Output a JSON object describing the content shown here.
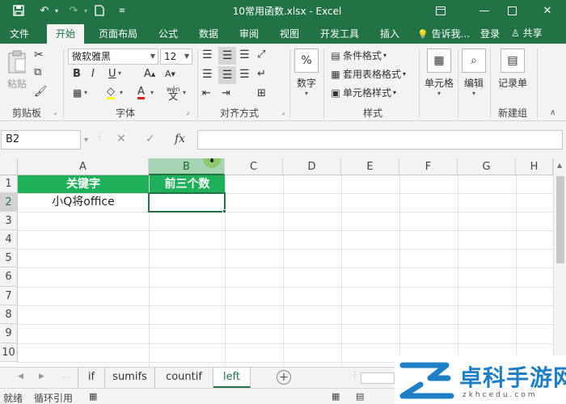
{
  "titlebar": {
    "title": "10常用函数.xlsx - Excel",
    "save_icon": "save-icon",
    "undo_icon": "undo-icon",
    "redo_icon": "redo-icon",
    "new_icon": "new-file-icon",
    "customize_icon": "customize-qat-icon"
  },
  "tabs": [
    {
      "label": "文件"
    },
    {
      "label": "开始"
    },
    {
      "label": "页面布局"
    },
    {
      "label": "公式"
    },
    {
      "label": "数据"
    },
    {
      "label": "审阅"
    },
    {
      "label": "视图"
    },
    {
      "label": "开发工具"
    },
    {
      "label": "插入"
    },
    {
      "label": "告诉我..."
    },
    {
      "label": "登录"
    }
  ],
  "share_label": "共享",
  "ribbon": {
    "paste_label": "粘贴",
    "clipboard_label": "剪贴板",
    "font_name": "微软雅黑",
    "font_size": "12",
    "font_label": "字体",
    "wen_label": "wén",
    "wen_char": "文",
    "alignment_label": "对齐方式",
    "number_label": "数字",
    "number_symbol": "%",
    "conditional_format": "条件格式",
    "table_format": "套用表格格式",
    "cell_style": "单元格样式",
    "styles_label": "样式",
    "cells_label": "单元格",
    "editing_label": "编辑",
    "record_label": "记录单",
    "new_group_label": "新建组",
    "bold": "B",
    "italic": "I",
    "underline": "U",
    "grow_font": "A",
    "shrink_font": "A",
    "font_color": "A"
  },
  "formula_bar": {
    "name_box": "B2",
    "cancel": "✕",
    "enter": "✓",
    "fx": "fx",
    "content": ""
  },
  "columns": [
    "A",
    "B",
    "C",
    "D",
    "E",
    "F",
    "G",
    "H"
  ],
  "rows": [
    "1",
    "2",
    "3",
    "4",
    "5",
    "6",
    "7",
    "8",
    "9",
    "10"
  ],
  "cells": {
    "A1": "关键字",
    "B1": "前三个数",
    "A2": "小Q将office",
    "B2": ""
  },
  "selected_cell": "B2",
  "sheets": [
    {
      "label": "if"
    },
    {
      "label": "sumifs"
    },
    {
      "label": "countif"
    },
    {
      "label": "left"
    }
  ],
  "active_sheet": "left",
  "status": {
    "ready": "就绪",
    "circular": "循环引用"
  },
  "watermark": {
    "title": "卓科手游网",
    "subtitle": "zkhcedu.com"
  },
  "colors": {
    "excel_green": "#217346",
    "header_fill": "#1fb15a",
    "selected_header": "#a7d3b5"
  }
}
